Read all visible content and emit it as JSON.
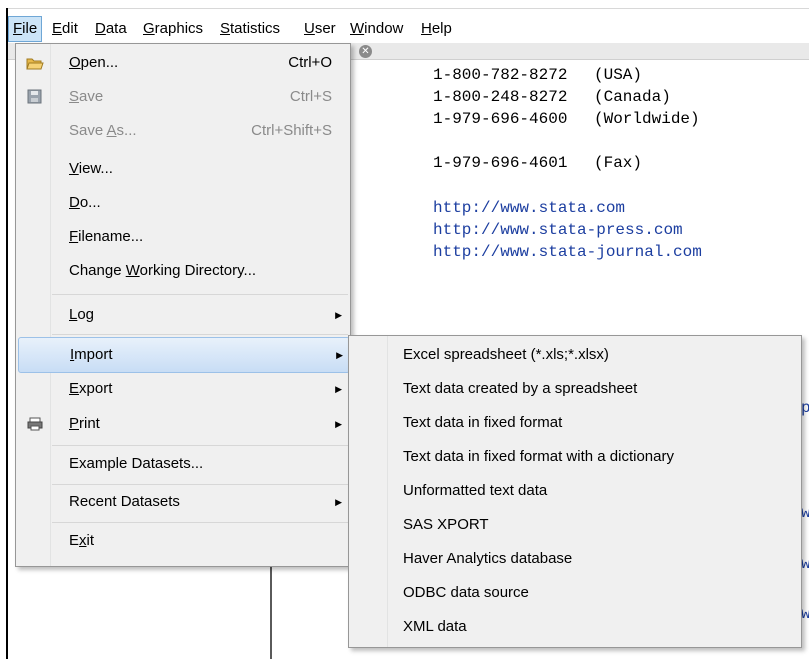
{
  "menubar": {
    "items": [
      {
        "label": "File",
        "accel": "F"
      },
      {
        "label": "Edit",
        "accel": "E"
      },
      {
        "label": "Data",
        "accel": "D"
      },
      {
        "label": "Graphics",
        "accel": "G"
      },
      {
        "label": "Statistics",
        "accel": "S"
      },
      {
        "label": "User",
        "accel": "U"
      },
      {
        "label": "Window",
        "accel": "W"
      },
      {
        "label": "Help",
        "accel": "H"
      }
    ]
  },
  "content": {
    "phones": [
      {
        "number": "1-800-782-8272",
        "label": "(USA)"
      },
      {
        "number": "1-800-248-8272",
        "label": "(Canada)"
      },
      {
        "number": "1-979-696-4600",
        "label": "(Worldwide)"
      },
      {
        "number": "1-979-696-4601",
        "label": "(Fax)"
      }
    ],
    "links": [
      "http://www.stata.com",
      "http://www.stata-press.com",
      "http://www.stata-journal.com"
    ],
    "partial_right": [
      "p",
      "w",
      "w",
      "w"
    ]
  },
  "file_menu": {
    "open": {
      "label": "Open...",
      "accel": "O",
      "shortcut": "Ctrl+O"
    },
    "save": {
      "label": "Save",
      "accel": "S",
      "shortcut": "Ctrl+S"
    },
    "save_as": {
      "label": "Save As...",
      "accel": "A",
      "shortcut": "Ctrl+Shift+S"
    },
    "view": {
      "label": "View...",
      "accel": "V"
    },
    "do": {
      "label": "Do...",
      "accel": "D"
    },
    "filename": {
      "label": "Filename...",
      "accel": "F"
    },
    "change_dir": {
      "label": "Change Working Directory...",
      "accel": "W"
    },
    "log": {
      "label": "Log",
      "accel": "L"
    },
    "import": {
      "label": "Import",
      "accel": "I"
    },
    "export": {
      "label": "Export",
      "accel": "E"
    },
    "print": {
      "label": "Print",
      "accel": "P"
    },
    "example": {
      "label": "Example Datasets..."
    },
    "recent": {
      "label": "Recent Datasets"
    },
    "exit": {
      "label": "Exit",
      "accel": "x"
    }
  },
  "import_submenu": {
    "items": [
      "Excel spreadsheet (*.xls;*.xlsx)",
      "Text data created by a spreadsheet",
      "Text data in fixed format",
      "Text data in fixed format with a dictionary",
      "Unformatted text data",
      "SAS XPORT",
      "Haver Analytics database",
      "ODBC data source",
      "XML data"
    ]
  },
  "colors": {
    "hover": "#cce4f7",
    "link": "#1c3ea0",
    "menu_bg": "#f0f0f0"
  }
}
